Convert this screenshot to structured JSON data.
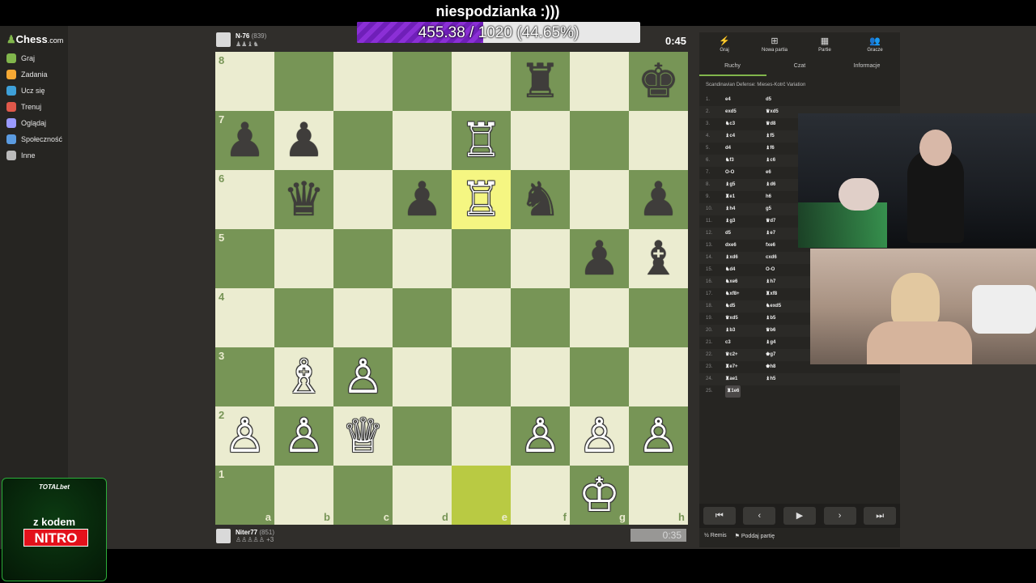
{
  "overlay": {
    "title": "niespodzianka :)))",
    "goal_text": "455.38 / 1020 (44.65%)",
    "goal_fraction": 0.4465
  },
  "sidebar": {
    "logo_main": "Chess",
    "logo_dom": ".com",
    "items": [
      {
        "label": "Graj",
        "color": "#81b64c"
      },
      {
        "label": "Zadania",
        "color": "#f7a934"
      },
      {
        "label": "Ucz się",
        "color": "#3ea0d8"
      },
      {
        "label": "Trenuj",
        "color": "#e0584a"
      },
      {
        "label": "Oglądaj",
        "color": "#9a9aff"
      },
      {
        "label": "Społeczność",
        "color": "#5b9be0"
      },
      {
        "label": "Inne",
        "color": "#bbbbbb"
      }
    ]
  },
  "top_player": {
    "name": "N-76",
    "rating": "(839)",
    "clock": "0:45"
  },
  "bottom_player": {
    "name": "Niter77",
    "rating": "(851)",
    "clock": "0:35"
  },
  "board": {
    "ranks": [
      "8",
      "7",
      "6",
      "5",
      "4",
      "3",
      "2",
      "1"
    ],
    "files": [
      "a",
      "b",
      "c",
      "d",
      "e",
      "f",
      "g",
      "h"
    ],
    "colors": {
      "light": "#ebecd0",
      "dark": "#779556",
      "hl_light": "#f5f682",
      "hl_dark": "#b9ca43"
    },
    "highlights": [
      "e6",
      "e1"
    ],
    "pieces": [
      {
        "sq": "f8",
        "p": "♜",
        "c": "b",
        "name": "black-rook"
      },
      {
        "sq": "h8",
        "p": "♚",
        "c": "b",
        "name": "black-king"
      },
      {
        "sq": "a7",
        "p": "♟",
        "c": "b",
        "name": "black-pawn"
      },
      {
        "sq": "b7",
        "p": "♟",
        "c": "b",
        "name": "black-pawn"
      },
      {
        "sq": "e7",
        "p": "♖",
        "c": "w",
        "name": "white-rook"
      },
      {
        "sq": "b6",
        "p": "♛",
        "c": "b",
        "name": "black-queen"
      },
      {
        "sq": "d6",
        "p": "♟",
        "c": "b",
        "name": "black-pawn"
      },
      {
        "sq": "e6",
        "p": "♖",
        "c": "w",
        "name": "white-rook"
      },
      {
        "sq": "f6",
        "p": "♞",
        "c": "b",
        "name": "black-knight"
      },
      {
        "sq": "h6",
        "p": "♟",
        "c": "b",
        "name": "black-pawn"
      },
      {
        "sq": "g5",
        "p": "♟",
        "c": "b",
        "name": "black-pawn"
      },
      {
        "sq": "h5",
        "p": "♝",
        "c": "b",
        "name": "black-bishop"
      },
      {
        "sq": "b3",
        "p": "♗",
        "c": "w",
        "name": "white-bishop"
      },
      {
        "sq": "c3",
        "p": "♙",
        "c": "w",
        "name": "white-pawn"
      },
      {
        "sq": "a2",
        "p": "♙",
        "c": "w",
        "name": "white-pawn"
      },
      {
        "sq": "b2",
        "p": "♙",
        "c": "w",
        "name": "white-pawn"
      },
      {
        "sq": "c2",
        "p": "♕",
        "c": "w",
        "name": "white-queen"
      },
      {
        "sq": "f2",
        "p": "♙",
        "c": "w",
        "name": "white-pawn"
      },
      {
        "sq": "g2",
        "p": "♙",
        "c": "w",
        "name": "white-pawn"
      },
      {
        "sq": "h2",
        "p": "♙",
        "c": "w",
        "name": "white-pawn"
      },
      {
        "sq": "g1",
        "p": "♔",
        "c": "w",
        "name": "white-king"
      }
    ]
  },
  "panel": {
    "tabs": [
      {
        "label": "Graj",
        "icon": "⚡"
      },
      {
        "label": "Nowa partia",
        "icon": "⊞"
      },
      {
        "label": "Partie",
        "icon": "▦"
      },
      {
        "label": "Gracze",
        "icon": "👥"
      }
    ],
    "subtabs": [
      "Ruchy",
      "Czat",
      "Informacje"
    ],
    "opening": "Scandinavian Defense: Mieses-Kotrč Variation",
    "moves": [
      {
        "n": "1.",
        "w": "e4",
        "b": "d5"
      },
      {
        "n": "2.",
        "w": "exd5",
        "b": "♛xd5"
      },
      {
        "n": "3.",
        "w": "♞c3",
        "b": "♛d8"
      },
      {
        "n": "4.",
        "w": "♝c4",
        "b": "♝f5"
      },
      {
        "n": "5.",
        "w": "d4",
        "b": "♝f6"
      },
      {
        "n": "6.",
        "w": "♞f3",
        "b": "♝c6"
      },
      {
        "n": "7.",
        "w": "O-O",
        "b": "e6"
      },
      {
        "n": "8.",
        "w": "♝g5",
        "b": "♝d6"
      },
      {
        "n": "9.",
        "w": "♜e1",
        "b": "h6"
      },
      {
        "n": "10.",
        "w": "♝h4",
        "b": "g5"
      },
      {
        "n": "11.",
        "w": "♝g3",
        "b": "♛d7"
      },
      {
        "n": "12.",
        "w": "d5",
        "b": "♝e7"
      },
      {
        "n": "13.",
        "w": "dxe6",
        "b": "fxe6"
      },
      {
        "n": "14.",
        "w": "♝xd6",
        "b": "cxd6"
      },
      {
        "n": "15.",
        "w": "♞d4",
        "b": "O-O"
      },
      {
        "n": "16.",
        "w": "♞xe6",
        "b": "♝h7"
      },
      {
        "n": "17.",
        "w": "♞xf8+",
        "b": "♜xf8"
      },
      {
        "n": "18.",
        "w": "♞d5",
        "b": "♞exd5"
      },
      {
        "n": "19.",
        "w": "♛xd5",
        "b": "♝b5"
      },
      {
        "n": "20.",
        "w": "♝b3",
        "b": "♛b6"
      },
      {
        "n": "21.",
        "w": "c3",
        "b": "♝g4"
      },
      {
        "n": "22.",
        "w": "♛c2+",
        "b": "♚g7"
      },
      {
        "n": "23.",
        "w": "♜e7+",
        "b": "♚h8"
      },
      {
        "n": "24.",
        "w": "♜ae1",
        "b": "♝h5"
      },
      {
        "n": "25.",
        "w": "♜1e6",
        "b": ""
      }
    ],
    "controls": [
      "⏮",
      "‹",
      "▶",
      "›",
      "⏭"
    ],
    "draw_label": "Remis",
    "resign_label": "Poddaj partię",
    "draw_icon": "½",
    "resign_icon": "⚑"
  },
  "ad": {
    "brand": "TOTALbet",
    "line1": "z kodem",
    "line2": "NITRO"
  }
}
